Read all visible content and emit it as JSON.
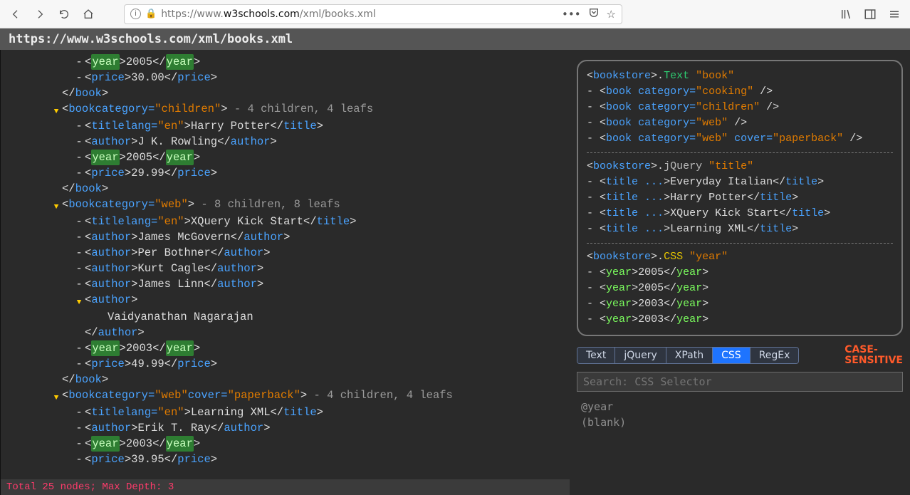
{
  "browser": {
    "url_prefix": "https://www.",
    "url_host": "w3schools.com",
    "url_path": "/xml/books.xml",
    "full_url": "https://www.w3schools.com/xml/books.xml"
  },
  "header": {
    "url_display": "https://www.w3schools.com/xml/books.xml"
  },
  "tree": {
    "lines": [
      {
        "indent": 3,
        "marker": "dash",
        "parts": [
          {
            "t": "open",
            "tag": "year",
            "style": "sel"
          },
          {
            "t": "text",
            "v": "2005"
          },
          {
            "t": "close",
            "tag": "year",
            "style": "sel"
          }
        ]
      },
      {
        "indent": 3,
        "marker": "dash",
        "parts": [
          {
            "t": "open",
            "tag": "price"
          },
          {
            "t": "text",
            "v": "30.00"
          },
          {
            "t": "close",
            "tag": "price"
          }
        ]
      },
      {
        "indent": 2,
        "marker": "none",
        "parts": [
          {
            "t": "close",
            "tag": "book"
          }
        ]
      },
      {
        "indent": 2,
        "marker": "arrow",
        "parts": [
          {
            "t": "open",
            "tag": "book",
            "attrs": [
              {
                "n": "category",
                "v": "children"
              }
            ]
          },
          {
            "t": "meta",
            "v": " - 4 children, 4 leafs"
          }
        ]
      },
      {
        "indent": 3,
        "marker": "dash",
        "parts": [
          {
            "t": "open",
            "tag": "title",
            "attrs": [
              {
                "n": "lang",
                "v": "en"
              }
            ]
          },
          {
            "t": "text",
            "v": "Harry Potter"
          },
          {
            "t": "close",
            "tag": "title"
          }
        ]
      },
      {
        "indent": 3,
        "marker": "dash",
        "parts": [
          {
            "t": "open",
            "tag": "author"
          },
          {
            "t": "text",
            "v": "J K. Rowling"
          },
          {
            "t": "close",
            "tag": "author"
          }
        ]
      },
      {
        "indent": 3,
        "marker": "dash",
        "parts": [
          {
            "t": "open",
            "tag": "year",
            "style": "sel"
          },
          {
            "t": "text",
            "v": "2005"
          },
          {
            "t": "close",
            "tag": "year",
            "style": "sel"
          }
        ]
      },
      {
        "indent": 3,
        "marker": "dash",
        "parts": [
          {
            "t": "open",
            "tag": "price"
          },
          {
            "t": "text",
            "v": "29.99"
          },
          {
            "t": "close",
            "tag": "price"
          }
        ]
      },
      {
        "indent": 2,
        "marker": "none",
        "parts": [
          {
            "t": "close",
            "tag": "book"
          }
        ]
      },
      {
        "indent": 2,
        "marker": "arrow",
        "parts": [
          {
            "t": "open",
            "tag": "book",
            "attrs": [
              {
                "n": "category",
                "v": "web"
              }
            ]
          },
          {
            "t": "meta",
            "v": " - 8 children, 8 leafs"
          }
        ]
      },
      {
        "indent": 3,
        "marker": "dash",
        "parts": [
          {
            "t": "open",
            "tag": "title",
            "attrs": [
              {
                "n": "lang",
                "v": "en"
              }
            ]
          },
          {
            "t": "text",
            "v": "XQuery Kick Start"
          },
          {
            "t": "close",
            "tag": "title"
          }
        ]
      },
      {
        "indent": 3,
        "marker": "dash",
        "parts": [
          {
            "t": "open",
            "tag": "author"
          },
          {
            "t": "text",
            "v": "James McGovern"
          },
          {
            "t": "close",
            "tag": "author"
          }
        ]
      },
      {
        "indent": 3,
        "marker": "dash",
        "parts": [
          {
            "t": "open",
            "tag": "author"
          },
          {
            "t": "text",
            "v": "Per Bothner"
          },
          {
            "t": "close",
            "tag": "author"
          }
        ]
      },
      {
        "indent": 3,
        "marker": "dash",
        "parts": [
          {
            "t": "open",
            "tag": "author"
          },
          {
            "t": "text",
            "v": "Kurt Cagle"
          },
          {
            "t": "close",
            "tag": "author"
          }
        ]
      },
      {
        "indent": 3,
        "marker": "dash",
        "parts": [
          {
            "t": "open",
            "tag": "author"
          },
          {
            "t": "text",
            "v": "James Linn"
          },
          {
            "t": "close",
            "tag": "author"
          }
        ]
      },
      {
        "indent": 3,
        "marker": "arrow",
        "parts": [
          {
            "t": "open",
            "tag": "author"
          }
        ]
      },
      {
        "indent": 4,
        "marker": "none",
        "parts": [
          {
            "t": "text",
            "v": "Vaidyanathan Nagarajan"
          }
        ]
      },
      {
        "indent": 3,
        "marker": "none",
        "parts": [
          {
            "t": "close",
            "tag": "author"
          }
        ]
      },
      {
        "indent": 3,
        "marker": "dash",
        "parts": [
          {
            "t": "open",
            "tag": "year",
            "style": "sel"
          },
          {
            "t": "text",
            "v": "2003"
          },
          {
            "t": "close",
            "tag": "year",
            "style": "sel"
          }
        ]
      },
      {
        "indent": 3,
        "marker": "dash",
        "parts": [
          {
            "t": "open",
            "tag": "price"
          },
          {
            "t": "text",
            "v": "49.99"
          },
          {
            "t": "close",
            "tag": "price"
          }
        ]
      },
      {
        "indent": 2,
        "marker": "none",
        "parts": [
          {
            "t": "close",
            "tag": "book"
          }
        ]
      },
      {
        "indent": 2,
        "marker": "arrow",
        "parts": [
          {
            "t": "open",
            "tag": "book",
            "attrs": [
              {
                "n": "category",
                "v": "web"
              },
              {
                "n": "cover",
                "v": "paperback"
              }
            ]
          },
          {
            "t": "meta",
            "v": " - 4 children, 4 leafs"
          }
        ]
      },
      {
        "indent": 3,
        "marker": "dash",
        "parts": [
          {
            "t": "open",
            "tag": "title",
            "attrs": [
              {
                "n": "lang",
                "v": "en"
              }
            ]
          },
          {
            "t": "text",
            "v": "Learning XML"
          },
          {
            "t": "close",
            "tag": "title"
          }
        ]
      },
      {
        "indent": 3,
        "marker": "dash",
        "parts": [
          {
            "t": "open",
            "tag": "author"
          },
          {
            "t": "text",
            "v": "Erik T. Ray"
          },
          {
            "t": "close",
            "tag": "author"
          }
        ]
      },
      {
        "indent": 3,
        "marker": "dash",
        "parts": [
          {
            "t": "open",
            "tag": "year",
            "style": "sel"
          },
          {
            "t": "text",
            "v": "2003"
          },
          {
            "t": "close",
            "tag": "year",
            "style": "sel"
          }
        ]
      },
      {
        "indent": 3,
        "marker": "dash",
        "parts": [
          {
            "t": "open",
            "tag": "price"
          },
          {
            "t": "text",
            "v": "39.95"
          },
          {
            "t": "close",
            "tag": "price"
          }
        ]
      }
    ]
  },
  "status": "Total 25 nodes; Max Depth: 3",
  "results": {
    "groups": [
      {
        "root": "bookstore",
        "kind": "Text",
        "kindClass": "kind-text",
        "query": "book",
        "lines": [
          {
            "type": "self",
            "tag": "book",
            "attrs": [
              {
                "n": "category",
                "v": "cooking"
              }
            ]
          },
          {
            "type": "self",
            "tag": "book",
            "attrs": [
              {
                "n": "category",
                "v": "children"
              }
            ]
          },
          {
            "type": "self",
            "tag": "book",
            "attrs": [
              {
                "n": "category",
                "v": "web"
              }
            ]
          },
          {
            "type": "self",
            "tag": "book",
            "attrs": [
              {
                "n": "category",
                "v": "web"
              },
              {
                "n": "cover",
                "v": "paperback"
              }
            ]
          }
        ]
      },
      {
        "root": "bookstore",
        "kind": "jQuery",
        "kindClass": "kind-jq",
        "query": "title",
        "lines": [
          {
            "type": "wrap",
            "tag": "title",
            "text": "Everyday Italian"
          },
          {
            "type": "wrap",
            "tag": "title",
            "text": "Harry Potter"
          },
          {
            "type": "wrap",
            "tag": "title",
            "text": "XQuery Kick Start"
          },
          {
            "type": "wrap",
            "tag": "title",
            "text": "Learning XML"
          }
        ]
      },
      {
        "root": "bookstore",
        "kind": "CSS",
        "kindClass": "kind-css",
        "query": "year",
        "lines": [
          {
            "type": "year",
            "tag": "year",
            "text": "2005"
          },
          {
            "type": "year",
            "tag": "year",
            "text": "2005"
          },
          {
            "type": "year",
            "tag": "year",
            "text": "2003"
          },
          {
            "type": "year",
            "tag": "year",
            "text": "2003"
          }
        ]
      }
    ]
  },
  "tabs": {
    "items": [
      "Text",
      "jQuery",
      "XPath",
      "CSS",
      "RegEx"
    ],
    "active": "CSS",
    "case_label_1": "CASE-",
    "case_label_2": "SENSITIVE"
  },
  "search": {
    "placeholder": "Search: CSS Selector",
    "value": ""
  },
  "history": [
    "@year",
    "(blank)"
  ]
}
